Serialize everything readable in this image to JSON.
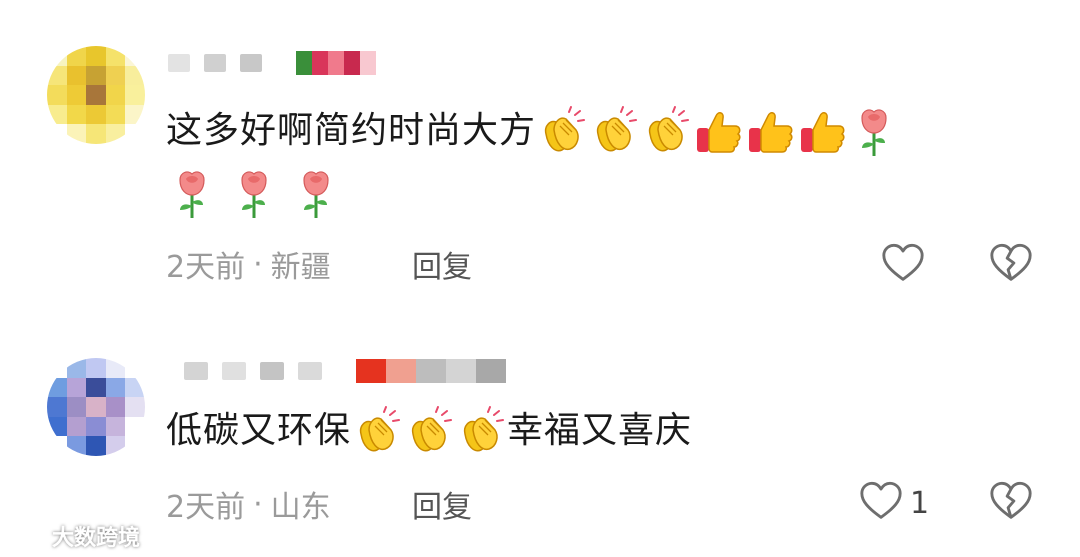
{
  "comments": [
    {
      "text": "这多好啊简约时尚大方",
      "emojis_inline": [
        "clapping-hands",
        "clapping-hands",
        "clapping-hands",
        "thumbs-up",
        "thumbs-up",
        "thumbs-up",
        "rose"
      ],
      "emojis_row2": [
        "rose",
        "rose",
        "rose"
      ],
      "time": "2天前",
      "separator": "·",
      "location": "新疆",
      "reply_label": "回复",
      "like_count": "",
      "avatar_colors": [
        "#f7f4c0",
        "#f0d54a",
        "#e8c62c",
        "#f5e26a",
        "#fbf6d6",
        "#f6e579",
        "#e9c12e",
        "#c7a233",
        "#efd051",
        "#f8ee9c",
        "#f3dc5b",
        "#eecb36",
        "#a8763a",
        "#f1d54a",
        "#f9f09c",
        "#f8ec8e",
        "#f2d849",
        "#ecc935",
        "#f3dc56",
        "#fbf5c8",
        "#ffffff",
        "#fbf3b8",
        "#f6e677",
        "#f9ef9f",
        "#ffffff"
      ],
      "username_colors": [
        "#e3e3e3",
        "#d0d0d0",
        "#c8c8c8"
      ],
      "badge_colors": [
        "#3a8f3a",
        "#d9365a",
        "#f07a8c",
        "#c8294e",
        "#f8c8d0"
      ]
    },
    {
      "text_before": "低碳又环保",
      "emojis_inline": [
        "clapping-hands",
        "clapping-hands",
        "clapping-hands"
      ],
      "text_after": "幸福又喜庆",
      "time": "2天前",
      "separator": "·",
      "location": "山东",
      "reply_label": "回复",
      "like_count": "1",
      "avatar_colors": [
        "#ffffff",
        "#9ab8e8",
        "#c0c8f2",
        "#e8eaf8",
        "#ffffff",
        "#6f9de0",
        "#b7a4d8",
        "#3a4d9a",
        "#8aa8e6",
        "#c8d4f4",
        "#4e78d2",
        "#9c8ec4",
        "#d8b2c8",
        "#a890c8",
        "#e4e0f2",
        "#3f6fcf",
        "#b49fd0",
        "#8a8dd4",
        "#c6b4dc",
        "#ffffff",
        "#ffffff",
        "#7a9ae0",
        "#2e56b4",
        "#d4cdec",
        "#ffffff"
      ],
      "username_colors": [
        "#d4d4d4",
        "#e0e0e0",
        "#c4c4c4",
        "#dadada"
      ],
      "badge_colors": [
        "#e5331f",
        "#f0a090",
        "#bdbdbd",
        "#d4d4d4",
        "#a8a8a8"
      ]
    }
  ],
  "watermark": {
    "text": "大数跨境",
    "icon": "logo-icon"
  },
  "colors": {
    "text_primary": "#1a1a1a",
    "text_meta": "#9a9a9a",
    "icon_stroke": "#6e6e6e"
  }
}
